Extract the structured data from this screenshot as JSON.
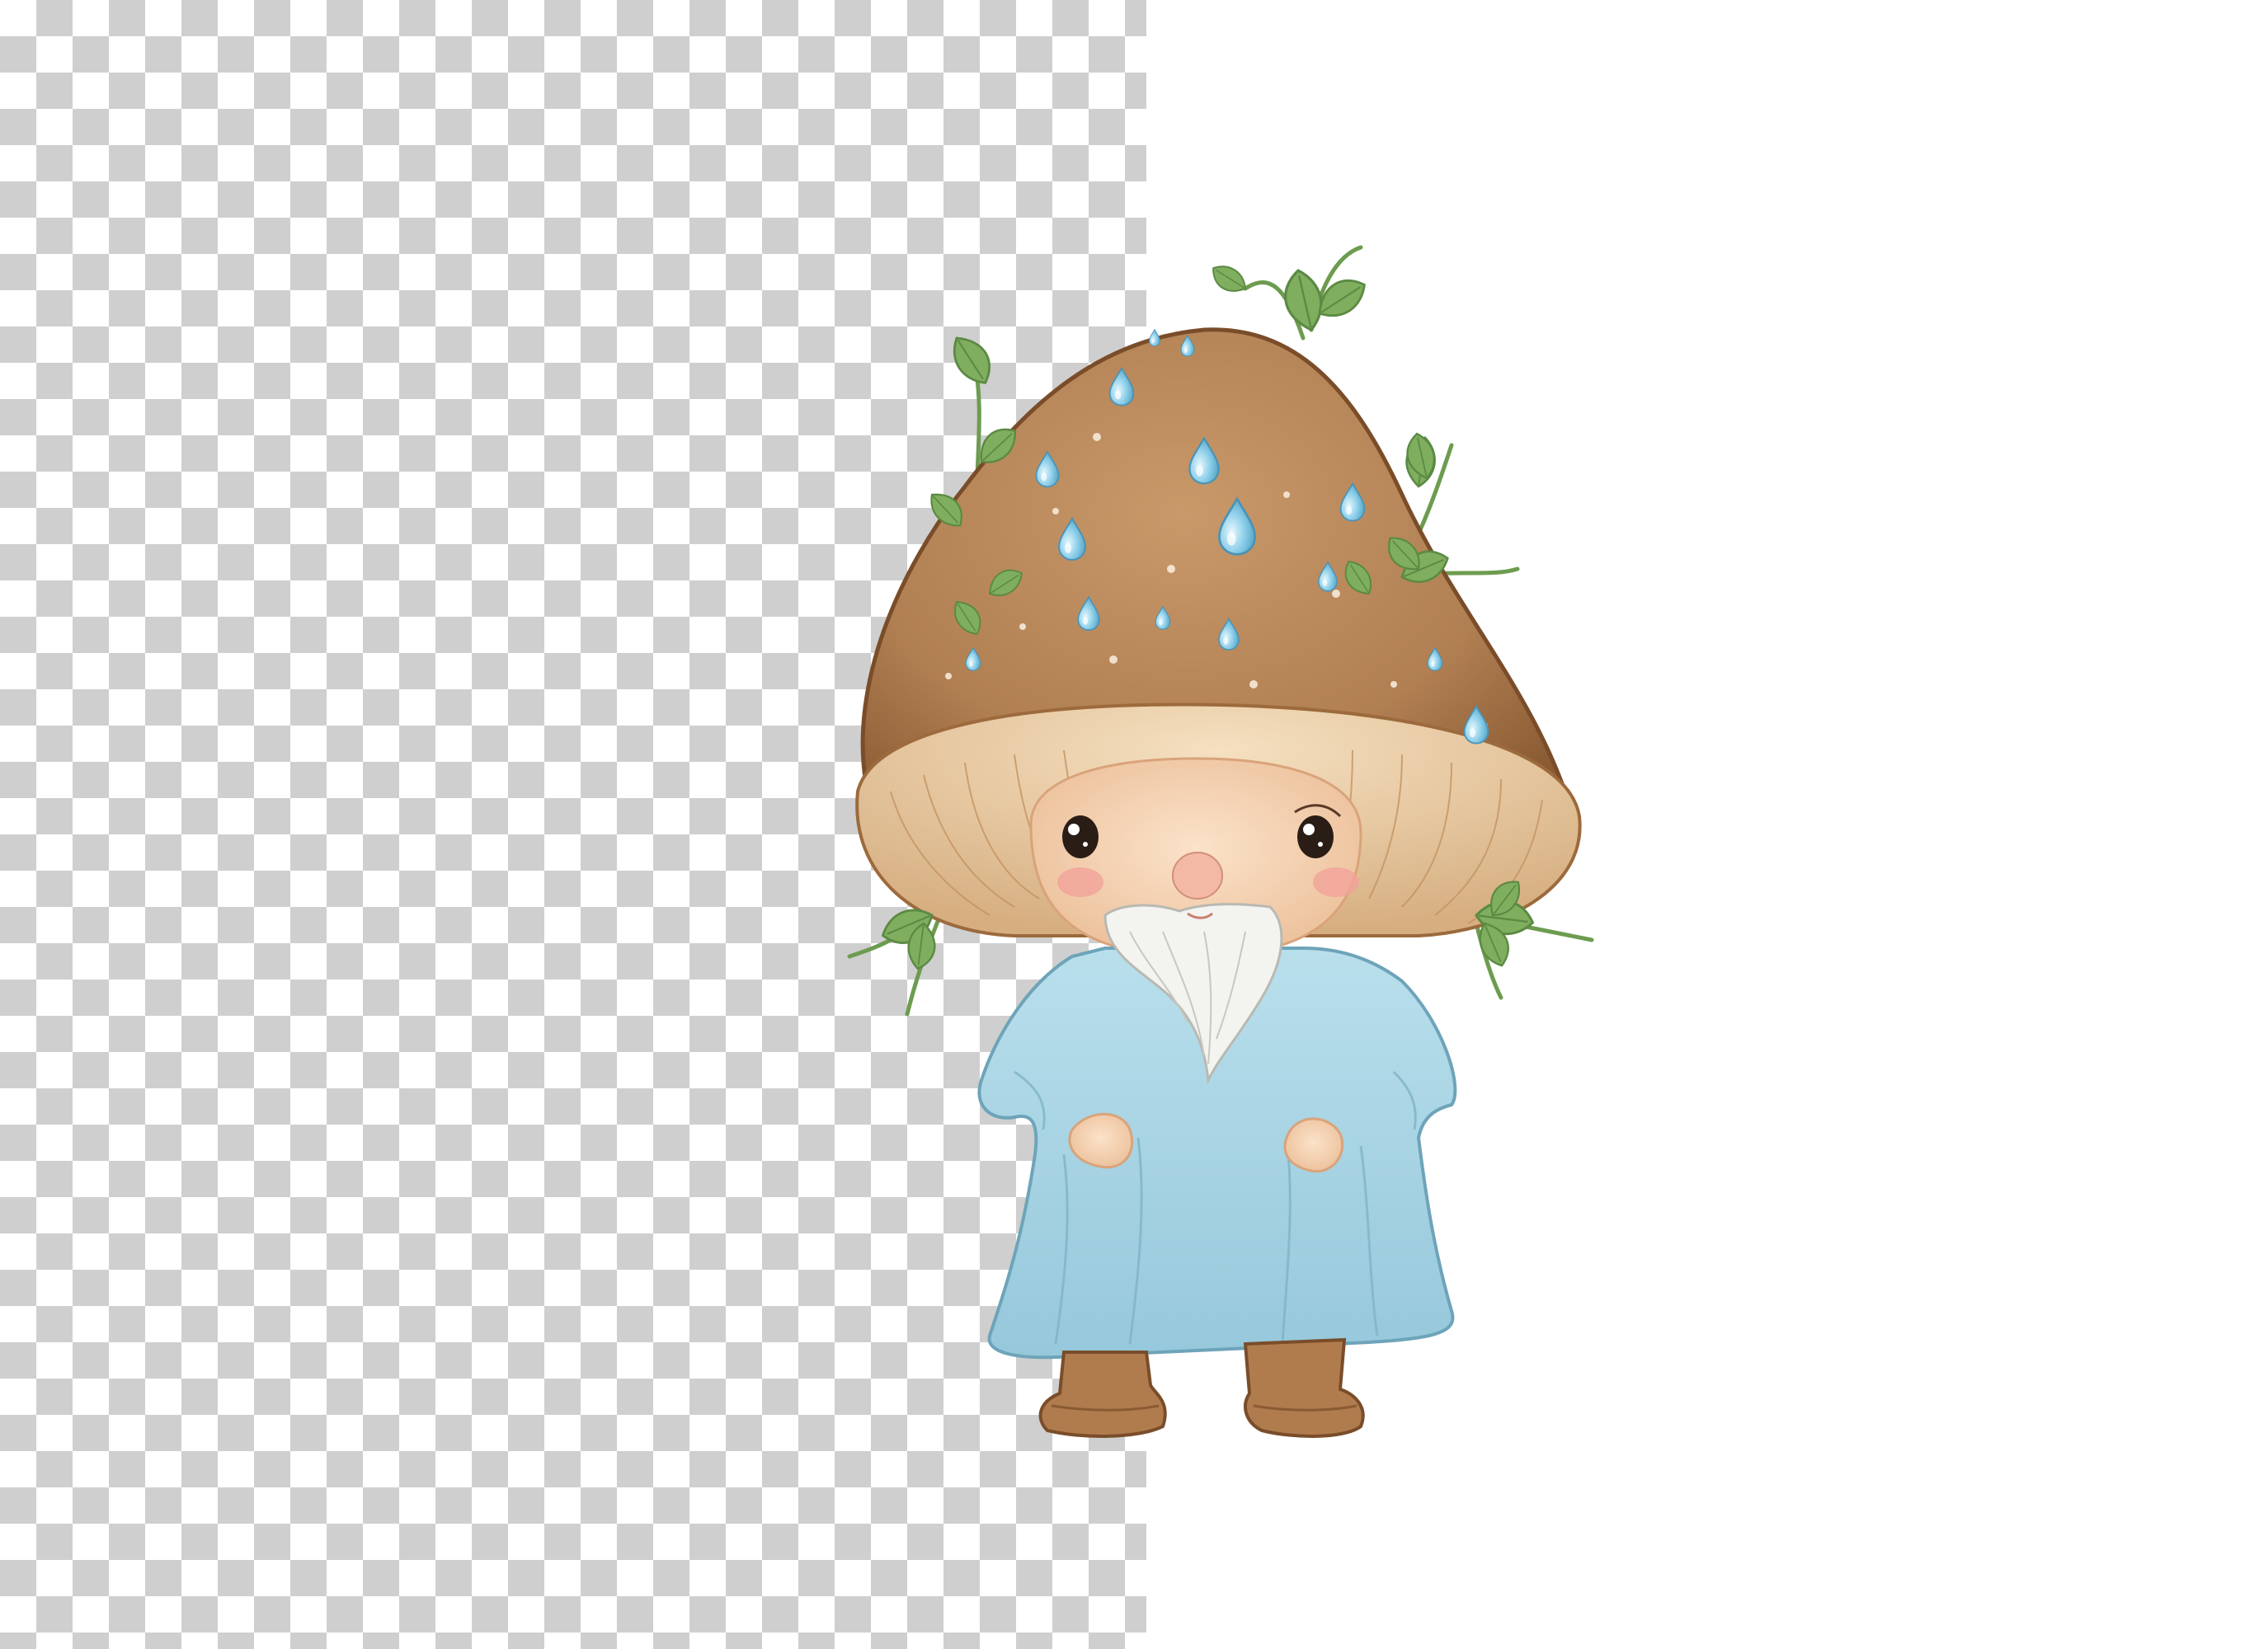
{
  "image": {
    "subject": "mushroom-gnome",
    "colors": {
      "checker_dark": "#cfcfcf",
      "checker_light": "#ffffff",
      "cap_brown": "#b07f52",
      "cap_dark": "#8a5a33",
      "gills": "#e7c9a1",
      "skin": "#f4d1b0",
      "cheek": "#f1a39a",
      "beard": "#f3f3f0",
      "robe_blue": "#a9d4e3",
      "robe_shadow": "#7fb4c8",
      "boot_brown": "#b07c4e",
      "leaf_green": "#7fae5f",
      "drop_blue": "#8fd0ea"
    },
    "icons": [
      "mushroom-cap",
      "water-drop",
      "leaf",
      "beard",
      "robe",
      "boot"
    ]
  }
}
